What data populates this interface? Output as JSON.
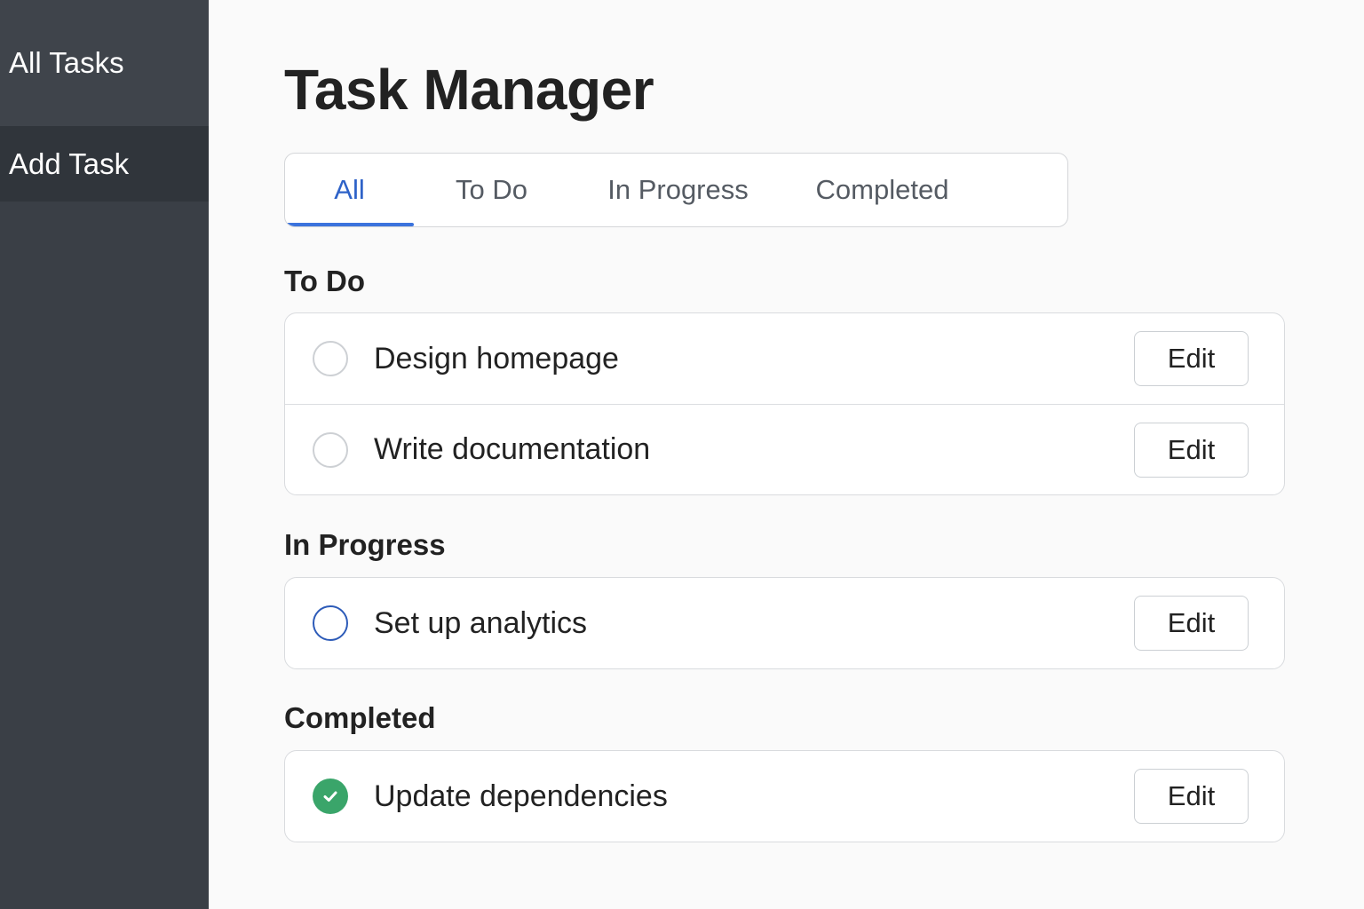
{
  "sidebar": {
    "items": [
      {
        "label": "All Tasks"
      },
      {
        "label": "Add Task"
      }
    ]
  },
  "main": {
    "title": "Task Manager",
    "tabs": [
      {
        "label": "All",
        "active": true
      },
      {
        "label": "To Do"
      },
      {
        "label": "In Progress"
      },
      {
        "label": "Completed"
      }
    ],
    "sections": [
      {
        "title": "To Do",
        "tasks": [
          {
            "name": "Design homepage",
            "status": "todo",
            "edit_label": "Edit"
          },
          {
            "name": "Write documentation",
            "status": "todo",
            "edit_label": "Edit"
          }
        ]
      },
      {
        "title": "In Progress",
        "tasks": [
          {
            "name": "Set up analytics",
            "status": "in-progress",
            "edit_label": "Edit"
          }
        ]
      },
      {
        "title": "Completed",
        "tasks": [
          {
            "name": "Update dependencies",
            "status": "completed",
            "edit_label": "Edit"
          }
        ]
      }
    ]
  },
  "colors": {
    "sidebar_bg": "#3a3f46",
    "accent": "#3b73dd",
    "in_progress_ring": "#2d5bb8",
    "completed_green": "#3aa56a"
  },
  "icons": {
    "todo": "empty-circle-icon",
    "in_progress": "blue-ring-icon",
    "completed": "check-circle-icon"
  }
}
